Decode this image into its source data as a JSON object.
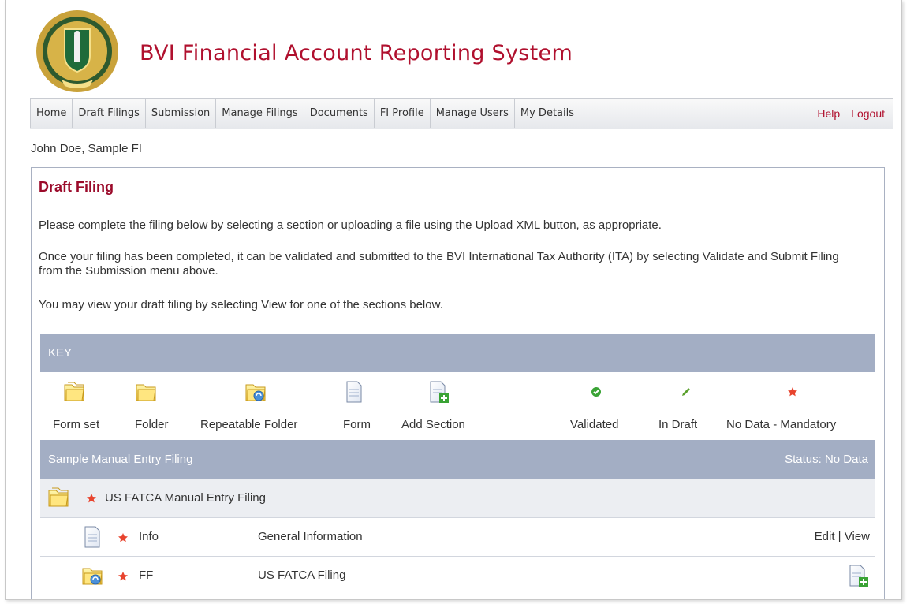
{
  "app": {
    "title": "BVI Financial Account Reporting System"
  },
  "nav": {
    "items": [
      {
        "label": "Home"
      },
      {
        "label": "Draft Filings"
      },
      {
        "label": "Submission"
      },
      {
        "label": "Manage Filings"
      },
      {
        "label": "Documents"
      },
      {
        "label": "FI Profile"
      },
      {
        "label": "Manage Users"
      },
      {
        "label": "My Details"
      }
    ],
    "help": "Help",
    "logout": "Logout"
  },
  "user_line": "John Doe, Sample FI",
  "panel": {
    "title": "Draft Filing",
    "para1": "Please complete the filing below by selecting a section or uploading a file using the Upload XML button, as appropriate.",
    "para2": "Once your filing has been completed, it can be validated and submitted to the BVI International Tax Authority (ITA) by selecting Validate and Submit Filing from the Submission menu above.",
    "para3": "You may view your draft filing by selecting View for one of the sections below."
  },
  "key": {
    "header": "KEY",
    "items": [
      {
        "label": "Form set",
        "icon": "form-set-icon"
      },
      {
        "label": "Folder",
        "icon": "folder-icon"
      },
      {
        "label": "Repeatable Folder",
        "icon": "repeatable-folder-icon"
      },
      {
        "label": "Form",
        "icon": "form-icon"
      },
      {
        "label": "Add Section",
        "icon": "add-section-icon"
      },
      {
        "label": "Validated",
        "icon": "validated-check-icon"
      },
      {
        "label": "In Draft",
        "icon": "in-draft-pencil-icon"
      },
      {
        "label": "No Data - Mandatory",
        "icon": "mandatory-star-icon"
      }
    ]
  },
  "filing": {
    "name": "Sample Manual Entry Filing",
    "status": "Status: No Data",
    "group": {
      "label": "US FATCA Manual Entry Filing"
    },
    "rows": [
      {
        "code": "Info",
        "description": "General Information",
        "edit": "Edit",
        "sep": "|",
        "view": "View"
      },
      {
        "code": "FF",
        "description": "US FATCA Filing"
      }
    ]
  },
  "colors": {
    "brand_red": "#b0102e",
    "header_bar": "#a3aec4",
    "validated": "#3aa335",
    "draft": "#5aa02c",
    "mandatory": "#e8442e"
  }
}
